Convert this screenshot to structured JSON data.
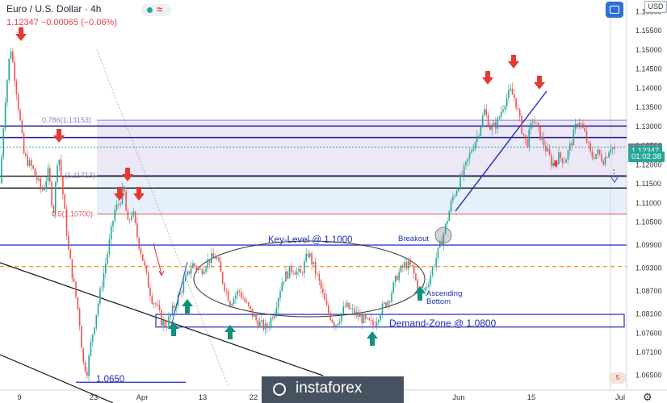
{
  "header": {
    "symbol": "Euro / U.S. Dollar",
    "timeframe": "4h",
    "quote": "1.12347  −0.00065 (−0.06%)"
  },
  "currency": "USD",
  "watermark": "instaforex",
  "colors": {
    "bull": "#26a69a",
    "bear": "#ef5350",
    "arrow_down": "#e53935",
    "arrow_up": "#138f7f",
    "level": "#1c1c8c",
    "fib": "#8c7cc8"
  },
  "price_tags": [
    {
      "label": "1.12412",
      "value": 1.12412,
      "color": "#787b86"
    },
    {
      "label": "1.12347",
      "value": 1.12347,
      "color": "#26a69a"
    },
    {
      "label": "01:02:38",
      "value": 1.1219,
      "color": "#26a69a"
    }
  ],
  "chart_data": {
    "type": "candlestick",
    "y_axis": {
      "ticks": [
        "1.16000",
        "1.15500",
        "1.15000",
        "1.14500",
        "1.14000",
        "1.13500",
        "1.13000",
        "1.12500",
        "1.12000",
        "1.11500",
        "1.11000",
        "1.10500",
        "1.09900",
        "1.09300",
        "1.08700",
        "1.08100",
        "1.07600",
        "1.07100",
        "1.06500"
      ],
      "range": [
        1.0625,
        1.1625
      ]
    },
    "x_axis": {
      "labels": [
        "9",
        "23",
        "Apr",
        "13",
        "22",
        "Jun",
        "15",
        "Jul"
      ]
    },
    "price_path": [
      [
        0,
        1.115
      ],
      [
        6,
        1.136
      ],
      [
        13,
        1.151
      ],
      [
        20,
        1.14
      ],
      [
        30,
        1.122
      ],
      [
        40,
        1.119
      ],
      [
        52,
        1.113
      ],
      [
        60,
        1.118
      ],
      [
        66,
        1.107
      ],
      [
        72,
        1.124
      ],
      [
        78,
        1.112
      ],
      [
        85,
        1.097
      ],
      [
        92,
        1.088
      ],
      [
        98,
        1.08
      ],
      [
        103,
        1.068
      ],
      [
        108,
        1.066
      ],
      [
        113,
        1.074
      ],
      [
        120,
        1.082
      ],
      [
        128,
        1.091
      ],
      [
        135,
        1.099
      ],
      [
        142,
        1.108
      ],
      [
        148,
        1.11
      ],
      [
        153,
        1.114
      ],
      [
        158,
        1.104
      ],
      [
        164,
        1.108
      ],
      [
        170,
        1.101
      ],
      [
        176,
        1.096
      ],
      [
        182,
        1.09
      ],
      [
        188,
        1.085
      ],
      [
        194,
        1.083
      ],
      [
        200,
        1.079
      ],
      [
        206,
        1.078
      ],
      [
        212,
        1.081
      ],
      [
        220,
        1.085
      ],
      [
        228,
        1.089
      ],
      [
        238,
        1.094
      ],
      [
        248,
        1.092
      ],
      [
        258,
        1.095
      ],
      [
        268,
        1.096
      ],
      [
        275,
        1.09
      ],
      [
        285,
        1.084
      ],
      [
        296,
        1.087
      ],
      [
        306,
        1.083
      ],
      [
        318,
        1.079
      ],
      [
        330,
        1.077
      ],
      [
        340,
        1.082
      ],
      [
        350,
        1.09
      ],
      [
        362,
        1.093
      ],
      [
        372,
        1.091
      ],
      [
        382,
        1.097
      ],
      [
        394,
        1.09
      ],
      [
        405,
        1.082
      ],
      [
        415,
        1.078
      ],
      [
        428,
        1.083
      ],
      [
        440,
        1.081
      ],
      [
        452,
        1.079
      ],
      [
        462,
        1.078
      ],
      [
        472,
        1.082
      ],
      [
        482,
        1.085
      ],
      [
        492,
        1.091
      ],
      [
        502,
        1.094
      ],
      [
        510,
        1.093
      ],
      [
        520,
        1.086
      ],
      [
        528,
        1.088
      ],
      [
        536,
        1.093
      ],
      [
        544,
        1.098
      ],
      [
        552,
        1.104
      ],
      [
        560,
        1.111
      ],
      [
        568,
        1.115
      ],
      [
        576,
        1.119
      ],
      [
        584,
        1.124
      ],
      [
        592,
        1.128
      ],
      [
        600,
        1.134
      ],
      [
        608,
        1.129
      ],
      [
        616,
        1.131
      ],
      [
        624,
        1.136
      ],
      [
        632,
        1.139
      ],
      [
        638,
        1.137
      ],
      [
        645,
        1.13
      ],
      [
        652,
        1.125
      ],
      [
        660,
        1.132
      ],
      [
        668,
        1.128
      ],
      [
        676,
        1.124
      ],
      [
        684,
        1.12
      ],
      [
        692,
        1.122
      ],
      [
        700,
        1.121
      ],
      [
        708,
        1.126
      ],
      [
        716,
        1.132
      ],
      [
        724,
        1.128
      ],
      [
        732,
        1.122
      ],
      [
        740,
        1.123
      ],
      [
        748,
        1.121
      ],
      [
        756,
        1.125
      ],
      [
        762,
        1.1235
      ]
    ],
    "horizontal_levels": [
      {
        "name": "level-1.1300",
        "value": 1.13,
        "color": "#1c1c8c"
      },
      {
        "name": "level-1.1270",
        "value": 1.127,
        "color": "#1c1c8c"
      },
      {
        "name": "level-1.1170",
        "value": 1.1169,
        "color": "#111111"
      },
      {
        "name": "level-1.1138",
        "value": 1.1138,
        "color": "#111111"
      },
      {
        "name": "level-1.0989",
        "value": 1.0989,
        "color": "#2f3bd8"
      },
      {
        "name": "level-1.0930",
        "value": 1.0933,
        "color": "#f29a2e",
        "dashed": true
      },
      {
        "name": "level-1.1245",
        "value": 1.1245,
        "color": "#26a69a",
        "dotted": true
      }
    ],
    "fib_levels": [
      {
        "label": "0.786(1.13153)",
        "value": 1.13153,
        "color": "#8c7cc8"
      },
      {
        "label": "(1.11713)",
        "value": 1.11713,
        "color": "#8c7cc8"
      },
      {
        "label": "0.5(1.10700)",
        "value": 1.107,
        "color": "#e05252"
      }
    ],
    "annotations": [
      {
        "label": "Key-Level @ 1.1000",
        "value": 1.1
      },
      {
        "label": "Breakout",
        "value": 1.1003
      },
      {
        "label": "Ascending",
        "value": 1.0857
      },
      {
        "label": "Bottom",
        "value": 1.0846
      },
      {
        "label": "Demand-Zone @ 1.0800",
        "value": 1.079
      },
      {
        "label": "1.0650",
        "value": 1.0656
      }
    ],
    "demand_zone": {
      "low": 1.0775,
      "high": 1.0808
    },
    "down_arrows": 9,
    "up_arrows": 6
  }
}
